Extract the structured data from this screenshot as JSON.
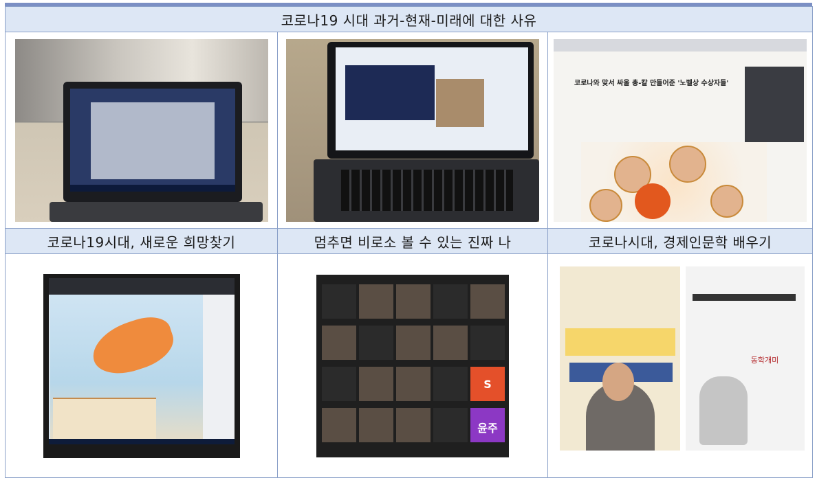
{
  "header": {
    "title": "코로나19 시대 과거-현재-미래에 대한 사유"
  },
  "captions": [
    "코로나19시대, 새로운 희망찾기",
    "멈추면 비로소 볼 수 있는 진짜 나",
    "코로나시대, 경제인문학 배우기"
  ],
  "news": {
    "title_line1": "코로나와 맞서 싸울 총-칼 만들어준 '노벨상 수상자들'"
  },
  "zoom_tiles": {
    "s": "S",
    "yunju": "윤주"
  },
  "slide": {
    "hakgye": "동학개미"
  },
  "colors": {
    "header_bg": "#dde7f5",
    "border": "#8aa0c8",
    "accent_bar": "#7b8fc4"
  }
}
